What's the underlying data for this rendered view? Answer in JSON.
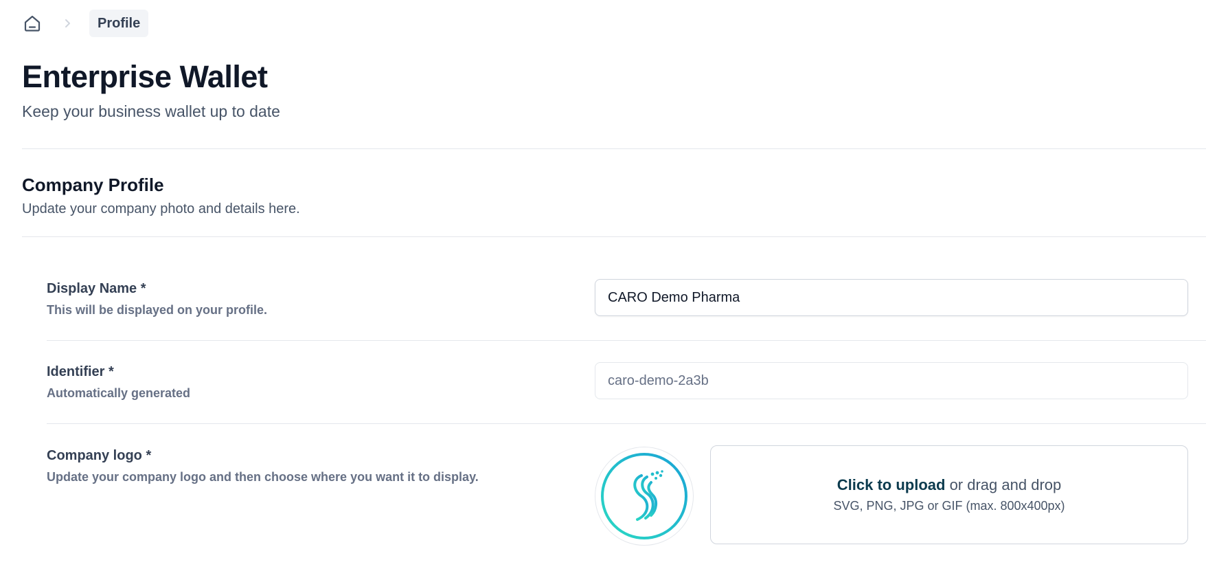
{
  "breadcrumb": {
    "home_icon": "home-icon",
    "separator_icon": "chevron-right-icon",
    "current": "Profile"
  },
  "header": {
    "title": "Enterprise Wallet",
    "subtitle": "Keep your business wallet up to date"
  },
  "section": {
    "title": "Company Profile",
    "subtitle": "Update your company photo and details here."
  },
  "fields": {
    "display_name": {
      "label": "Display Name *",
      "hint": "This will be displayed on your profile.",
      "value": "CARO Demo Pharma"
    },
    "identifier": {
      "label": "Identifier *",
      "hint": "Automatically generated",
      "value": "caro-demo-2a3b"
    },
    "logo": {
      "label": "Company logo *",
      "hint": "Update your company logo and then choose where you want it to display.",
      "upload_link": "Click to upload",
      "upload_rest": " or drag and drop",
      "upload_hint": "SVG, PNG, JPG or GIF (max. 800x400px)"
    }
  },
  "colors": {
    "logo_gradient_start": "#2bd9c3",
    "logo_gradient_end": "#1aa3d6"
  }
}
